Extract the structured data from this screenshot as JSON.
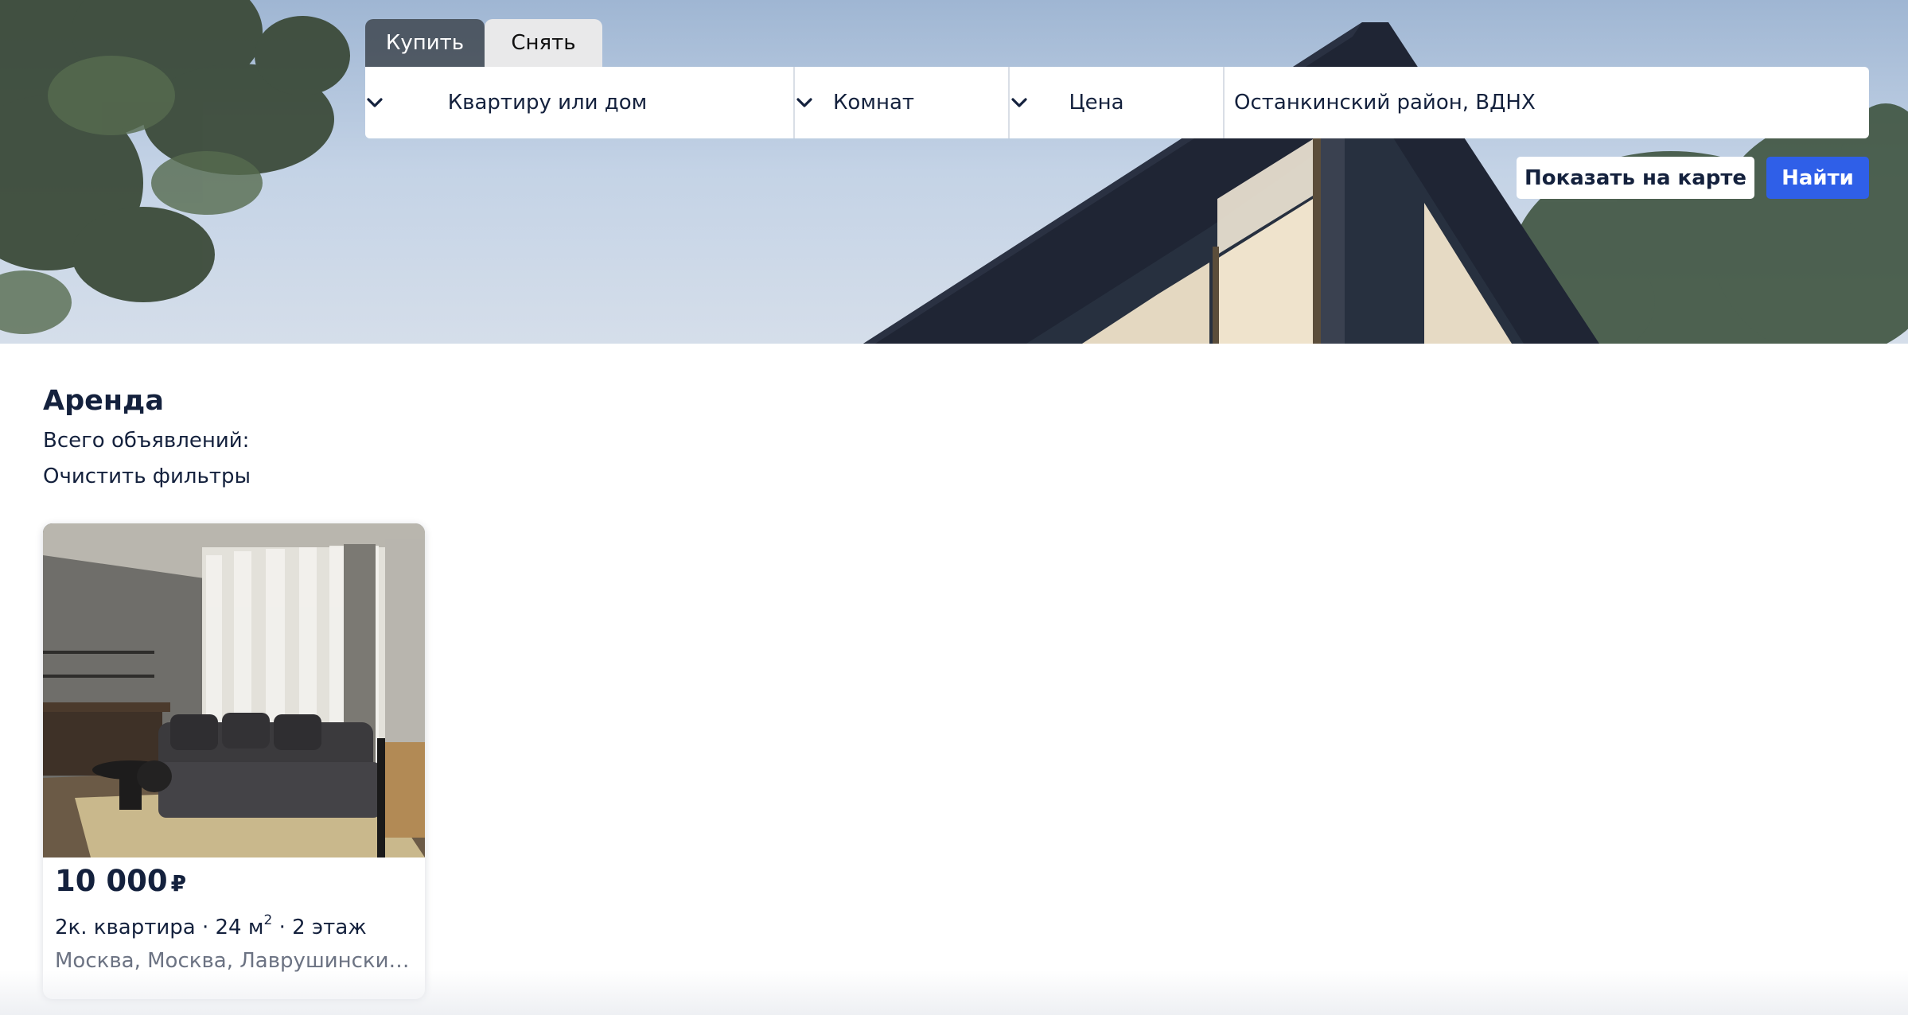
{
  "tabs": [
    {
      "label": "Купить",
      "active": false
    },
    {
      "label": "Снять",
      "active": true
    }
  ],
  "search": {
    "property_type": "Квартиру или дом",
    "rooms": "Комнат",
    "price": "Цена",
    "location": "Останкинский район, ВДНХ",
    "chevron_icon": "chevron-down-icon"
  },
  "actions": {
    "show_on_map": "Показать на карте",
    "find": "Найти"
  },
  "results": {
    "title": "Аренда",
    "total_label": "Всего объявлений:",
    "clear_filters": "Очистить фильтры"
  },
  "listings": [
    {
      "price": "10 000",
      "currency": "₽",
      "specs_prefix": "2к. квартира · 24 м",
      "specs_sup": "2",
      "specs_suffix": " · 2 этаж",
      "address": "Москва, Москва, Лаврушинский переулок"
    }
  ],
  "colors": {
    "accent": "#2f5fe8",
    "text_dark": "#14213d",
    "text_muted": "#6c7383",
    "tab_active_bg": "#e9e9ea",
    "tab_inactive_bg": "#2d3237"
  }
}
